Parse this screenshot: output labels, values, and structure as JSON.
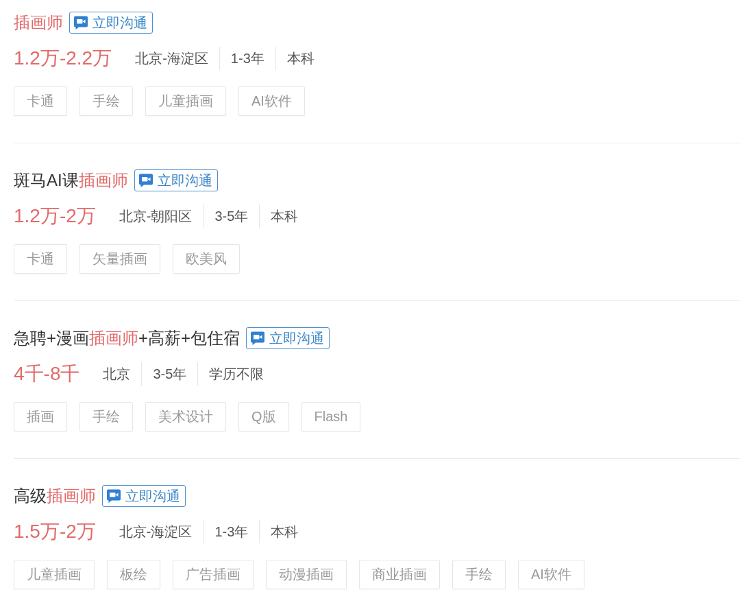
{
  "jobs": [
    {
      "title": [
        {
          "text": "插画师",
          "highlighted": true
        }
      ],
      "chat_button": "立即沟通",
      "salary": "1.2万-2.2万",
      "location": "北京-海淀区",
      "experience": "1-3年",
      "education": "本科",
      "tags": [
        "卡通",
        "手绘",
        "儿童插画",
        "AI软件"
      ]
    },
    {
      "title": [
        {
          "text": "斑马AI课",
          "highlighted": false
        },
        {
          "text": "插画师",
          "highlighted": true
        }
      ],
      "chat_button": "立即沟通",
      "salary": "1.2万-2万",
      "location": "北京-朝阳区",
      "experience": "3-5年",
      "education": "本科",
      "tags": [
        "卡通",
        "矢量插画",
        "欧美风"
      ]
    },
    {
      "title": [
        {
          "text": "急聘+漫画",
          "highlighted": false
        },
        {
          "text": "插画师",
          "highlighted": true
        },
        {
          "text": "+高薪+包住宿",
          "highlighted": false
        }
      ],
      "chat_button": "立即沟通",
      "salary": "4千-8千",
      "location": "北京",
      "experience": "3-5年",
      "education": "学历不限",
      "tags": [
        "插画",
        "手绘",
        "美术设计",
        "Q版",
        "Flash"
      ]
    },
    {
      "title": [
        {
          "text": "高级",
          "highlighted": false
        },
        {
          "text": "插画师",
          "highlighted": true
        }
      ],
      "chat_button": "立即沟通",
      "salary": "1.5万-2万",
      "location": "北京-海淀区",
      "experience": "1-3年",
      "education": "本科",
      "tags": [
        "儿童插画",
        "板绘",
        "广告插画",
        "动漫插画",
        "商业插画",
        "手绘",
        "AI软件"
      ]
    }
  ]
}
